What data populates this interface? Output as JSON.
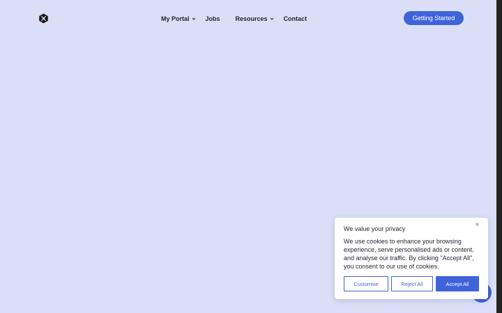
{
  "nav": {
    "items": [
      {
        "label": "My Portal",
        "has_dropdown": true
      },
      {
        "label": "Jobs",
        "has_dropdown": false
      },
      {
        "label": "Resources",
        "has_dropdown": true
      },
      {
        "label": "Contact",
        "has_dropdown": false
      }
    ],
    "cta_label": "Getting Started"
  },
  "cookie_banner": {
    "title": "We value your privacy",
    "body": "We use cookies to enhance your browsing experience, serve personalised ads or content, and analyse our traffic. By clicking \"Accept All\", you consent to our use of cookies.",
    "customise_label": "Customise",
    "reject_label": "Reject All",
    "accept_label": "Accept All"
  },
  "icons": {
    "logo": "brand-logo-icon",
    "close": "close-icon",
    "dropdown": "chevron-down-icon",
    "chat": "chat-launcher-icon"
  },
  "colors": {
    "background": "#dadff7",
    "accent": "#3f63d8",
    "text": "#1f2233"
  }
}
